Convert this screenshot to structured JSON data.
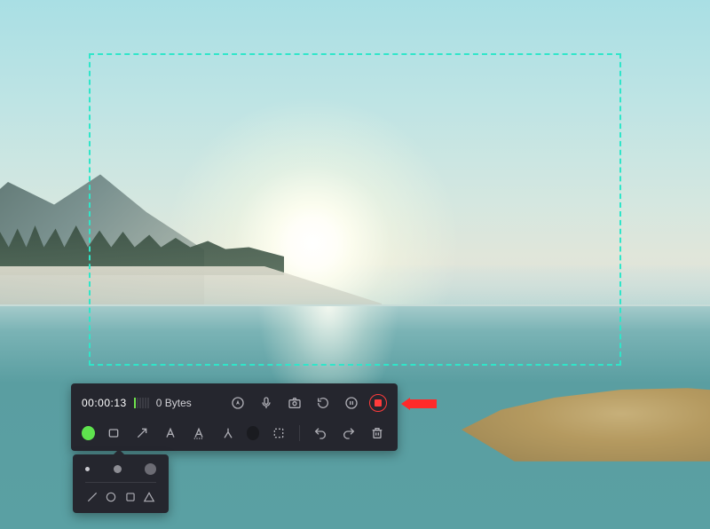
{
  "status": {
    "timer": "00:00:13",
    "filesize": "0 Bytes"
  },
  "callout": {
    "arrow_color": "#ff2a2a"
  },
  "colors": {
    "selection_border": "#2fe6c9",
    "active_tool_color": "#5fe34e",
    "stop_color": "#ff3b3b"
  }
}
